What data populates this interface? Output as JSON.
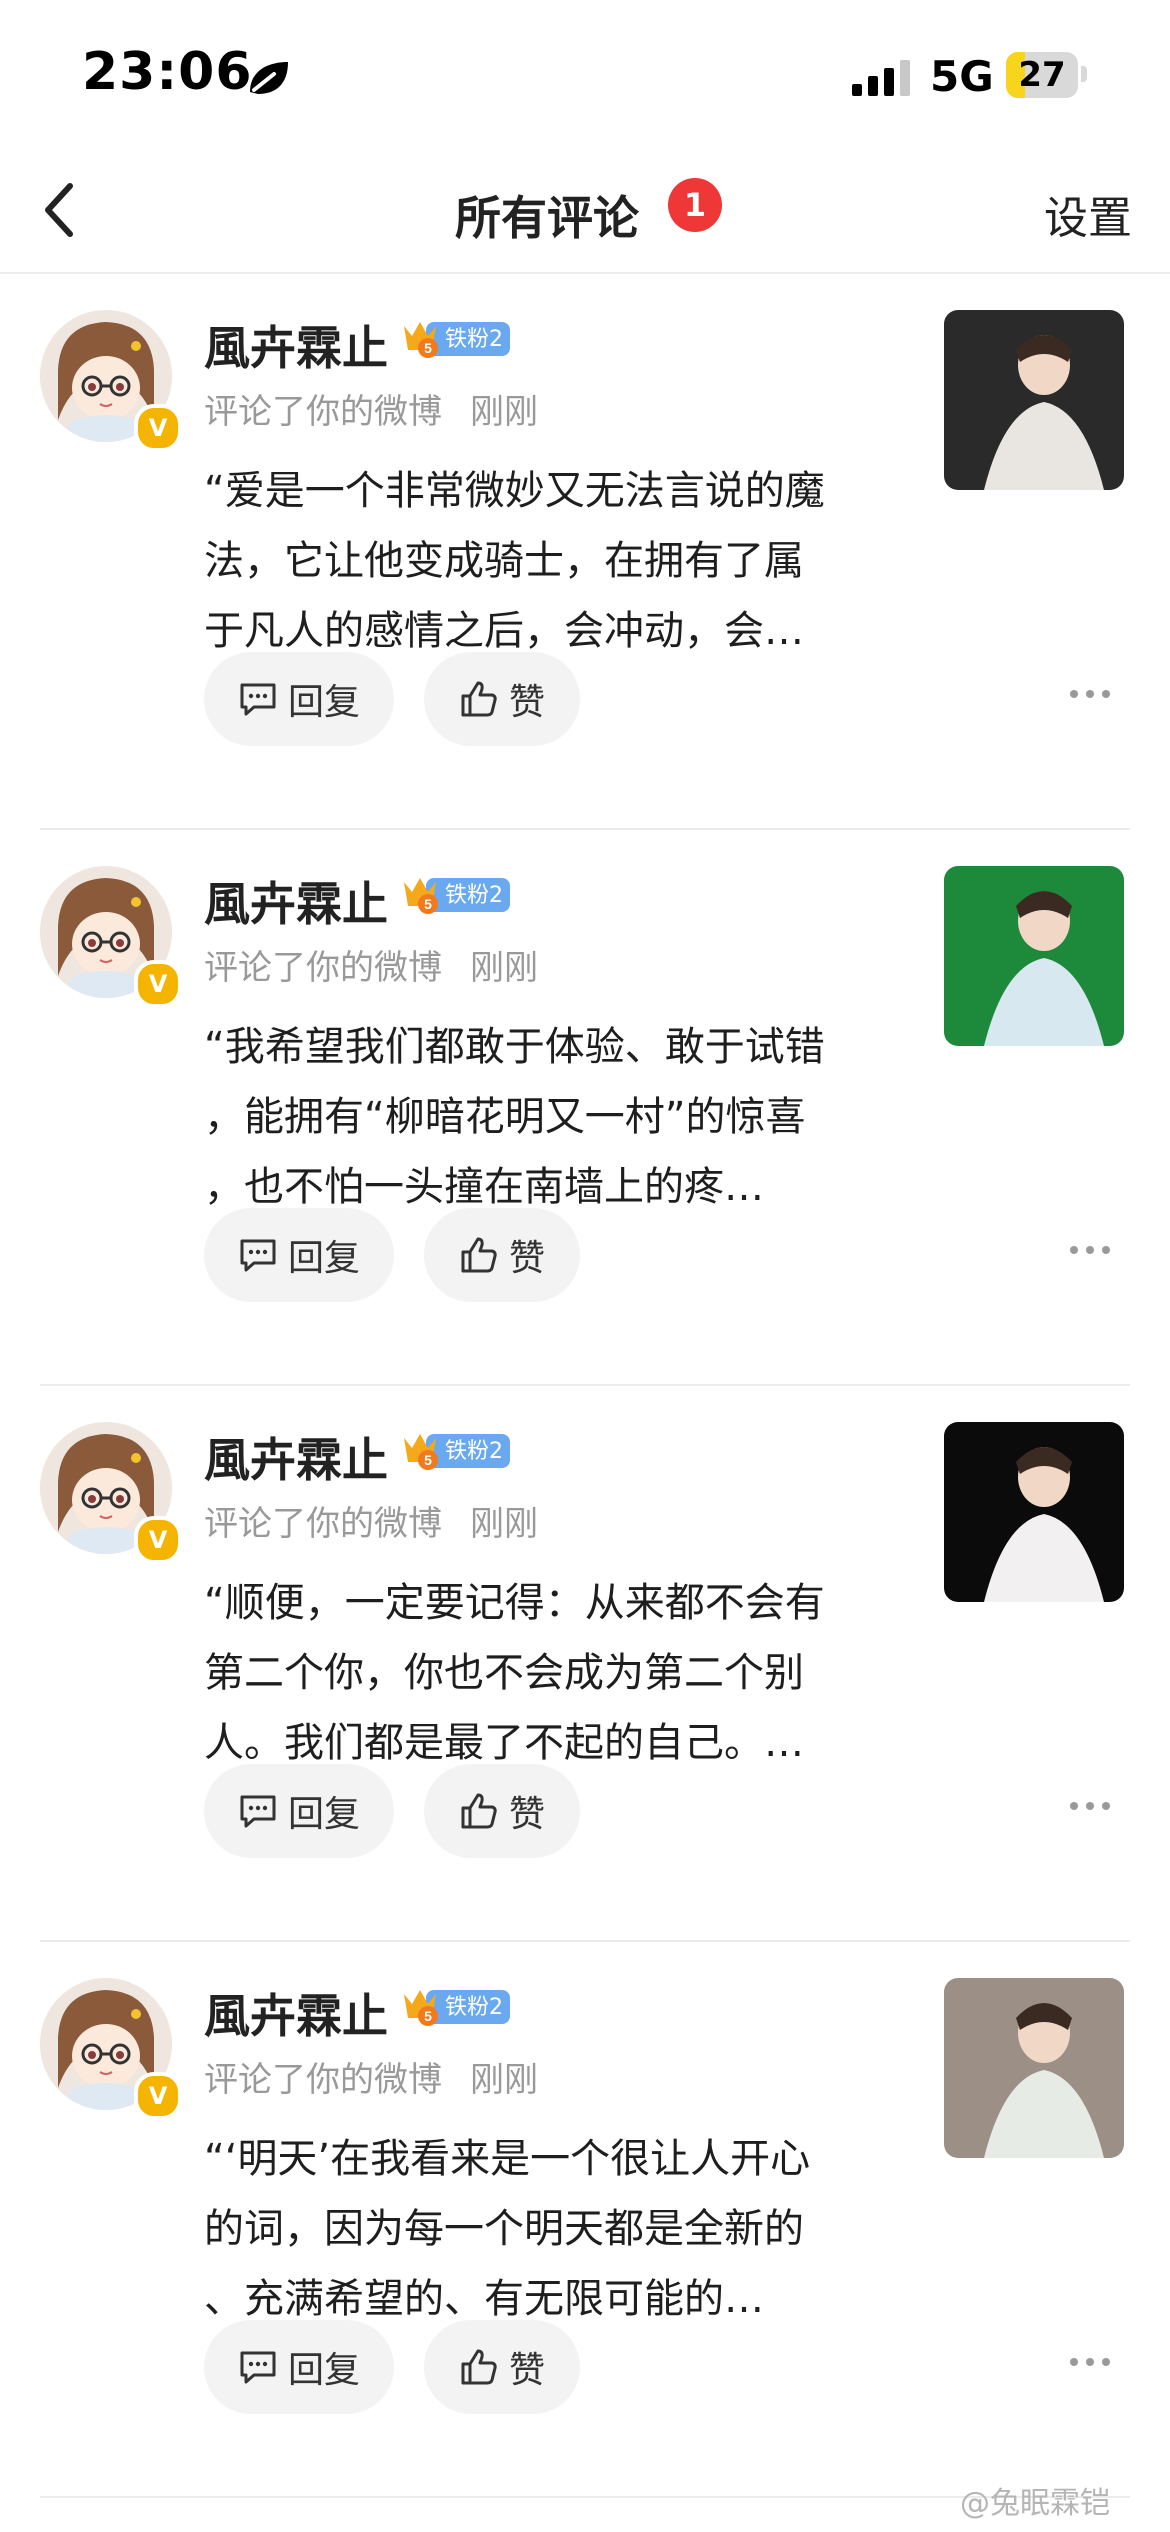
{
  "status": {
    "time": "23:06",
    "network": "5G",
    "battery": "27",
    "battery_level": 0.27
  },
  "nav": {
    "title": "所有评论",
    "badge": "1",
    "settings": "设置"
  },
  "comments": [
    {
      "username": "風卉霖止",
      "fan_badge": "铁粉2",
      "action": "评论了你的微博",
      "time": "刚刚",
      "lines": [
        "“爱是一个非常微妙又无法言说的魔",
        "法，它让他变成骑士，在拥有了属",
        "于凡人的感情之后，会冲动，会…"
      ],
      "reply_label": "回复",
      "like_label": "赞"
    },
    {
      "username": "風卉霖止",
      "fan_badge": "铁粉2",
      "action": "评论了你的微博",
      "time": "刚刚",
      "lines": [
        "“我希望我们都敢于体验、敢于试错",
        "，能拥有“柳暗花明又一村”的惊喜",
        "，也不怕一头撞在南墙上的疼…"
      ],
      "reply_label": "回复",
      "like_label": "赞"
    },
    {
      "username": "風卉霖止",
      "fan_badge": "铁粉2",
      "action": "评论了你的微博",
      "time": "刚刚",
      "lines": [
        "“顺便，一定要记得：从来都不会有",
        "第二个你，你也不会成为第二个别",
        "人。我们都是最了不起的自己。…"
      ],
      "reply_label": "回复",
      "like_label": "赞"
    },
    {
      "username": "風卉霖止",
      "fan_badge": "铁粉2",
      "action": "评论了你的微博",
      "time": "刚刚",
      "lines": [
        "“‘明天’在我看来是一个很让人开心",
        "的词，因为每一个明天都是全新的",
        "、充满希望的、有无限可能的…"
      ],
      "reply_label": "回复",
      "like_label": "赞"
    }
  ],
  "watermark": "@兔眠霖铠"
}
